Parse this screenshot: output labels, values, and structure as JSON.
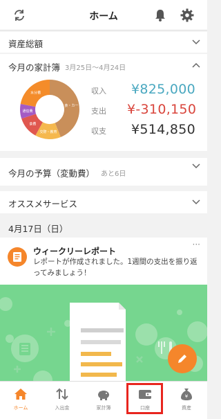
{
  "header": {
    "title": "ホーム"
  },
  "assets": {
    "title": "資産総額"
  },
  "household": {
    "title": "今月の家計簿",
    "period": "3月25日〜4月24日",
    "income_label": "収入",
    "income_value": "¥825,000",
    "expense_label": "支出",
    "expense_value": "¥-310,150",
    "balance_label": "収支",
    "balance_value": "¥514,850",
    "donut_labels": [
      "食・カー",
      "交際・教育",
      "食費",
      "通信費",
      "水分費"
    ],
    "colors": {
      "income": "#4aa8c0",
      "expense": "#d9453c",
      "balance": "#333333"
    }
  },
  "chart_data": {
    "type": "pie",
    "categories": [
      "食・カー",
      "交際・教育",
      "食費",
      "通信費",
      "水分費"
    ],
    "values": [
      44,
      14,
      12,
      8,
      22
    ],
    "colors": [
      "#c98f5a",
      "#f5b84e",
      "#e0574f",
      "#a45bc4",
      "#f48c2a"
    ]
  },
  "budget": {
    "title": "今月の予算（変動費）",
    "days_left": "あと6日"
  },
  "services": {
    "title": "オススメサービス"
  },
  "date_heading": "4月17日（日）",
  "report": {
    "title": "ウィークリーレポート",
    "body": "レポートが作成されました。1週間の支出を振り返ってみましょう！",
    "more": "···"
  },
  "tabs": [
    {
      "label": "ホーム",
      "icon": "home-icon",
      "active": true
    },
    {
      "label": "入出金",
      "icon": "transfer-icon",
      "active": false
    },
    {
      "label": "家計簿",
      "icon": "piggy-bank-icon",
      "active": false
    },
    {
      "label": "口座",
      "icon": "wallet-icon",
      "active": false
    },
    {
      "label": "資産",
      "icon": "money-bag-icon",
      "active": false
    }
  ],
  "accent_color": "#f5862b",
  "banner_color": "#76d68f"
}
